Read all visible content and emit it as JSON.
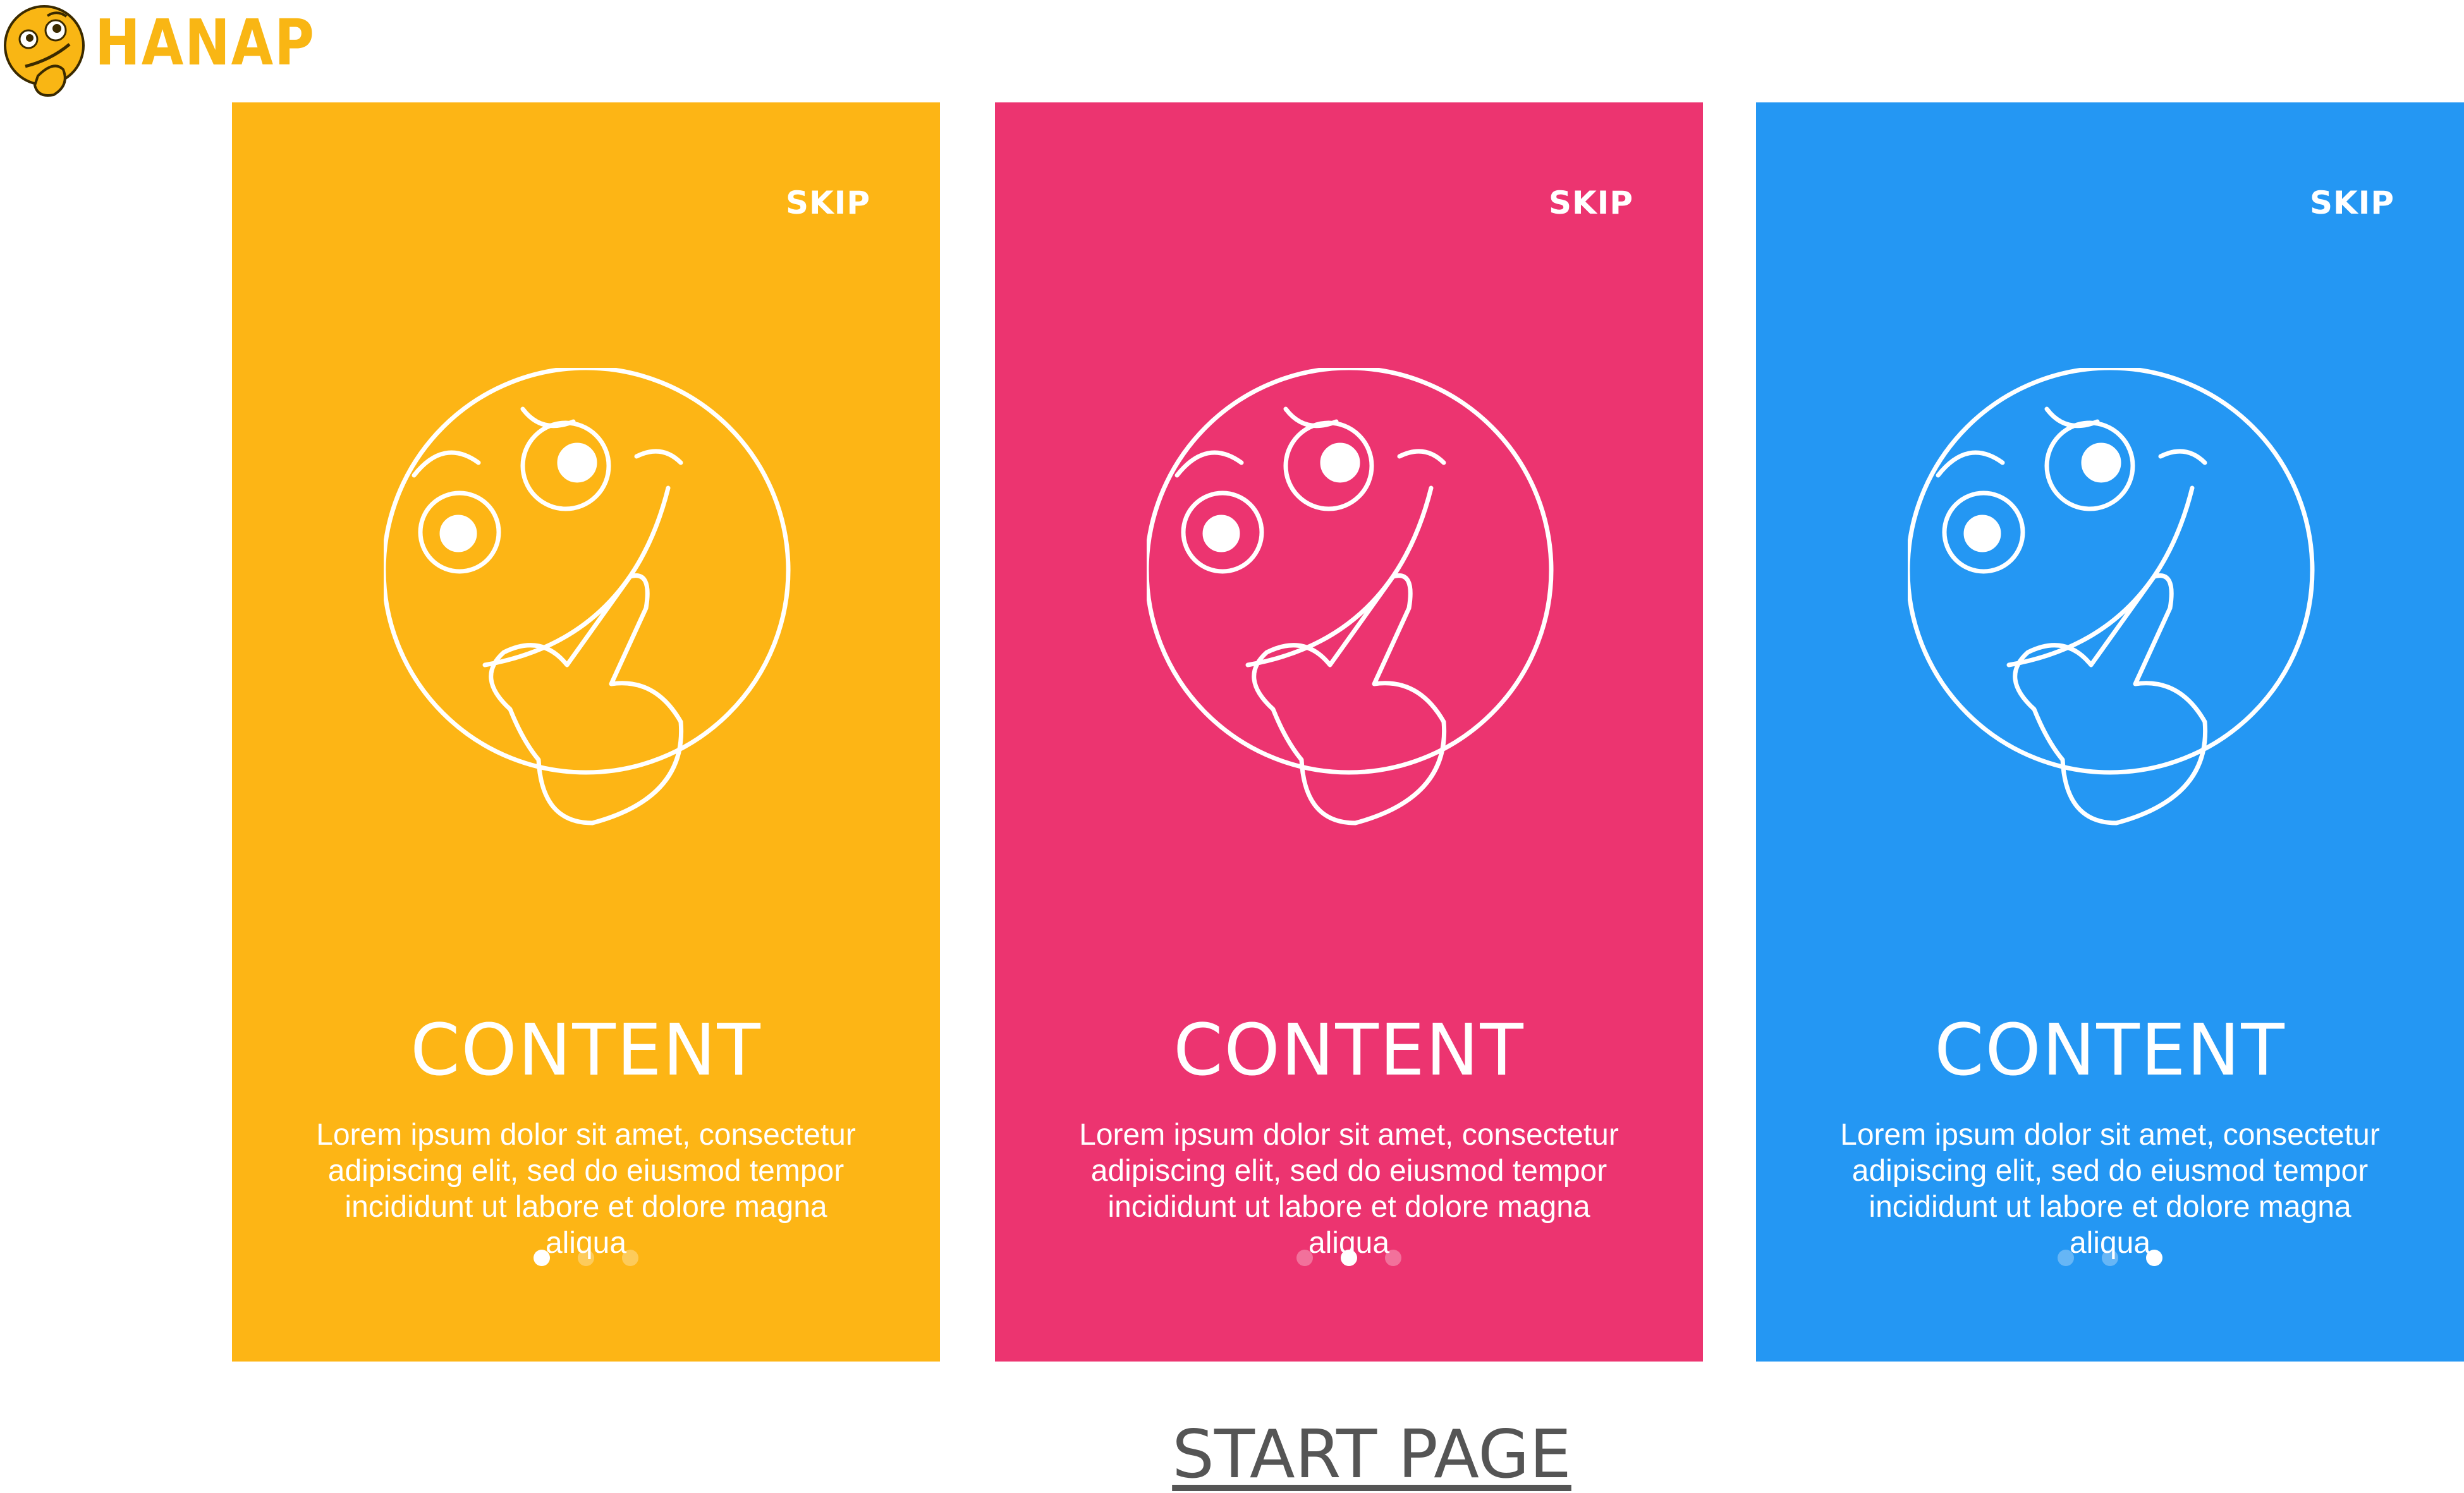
{
  "brand": {
    "name": "HANAP",
    "color": "#F9B614"
  },
  "cards": [
    {
      "color": "#FDB515",
      "skip_label": "SKIP",
      "title": "CONTENT",
      "body": "Lorem ipsum dolor sit amet, consectetur adipiscing elit, sed do eiusmod tempor incididunt ut labore et dolore magna aliqua",
      "active_dot": 1,
      "dot_count": 3
    },
    {
      "color": "#EC3470",
      "skip_label": "SKIP",
      "title": "CONTENT",
      "body": "Lorem ipsum dolor sit amet, consectetur adipiscing elit, sed do eiusmod tempor incididunt ut labore et dolore magna aliqua",
      "active_dot": 2,
      "dot_count": 3
    },
    {
      "color": "#2497F3",
      "skip_label": "SKIP",
      "title": "CONTENT",
      "body": "Lorem ipsum dolor sit amet, consectetur adipiscing elit, sed do eiusmod tempor incididunt ut labore et dolore magna aliqua",
      "active_dot": 3,
      "dot_count": 3
    }
  ],
  "icons": {
    "logo": "thinking-face-icon",
    "illustration": "thinking-face-icon"
  },
  "footer": {
    "label": "START PAGE"
  }
}
